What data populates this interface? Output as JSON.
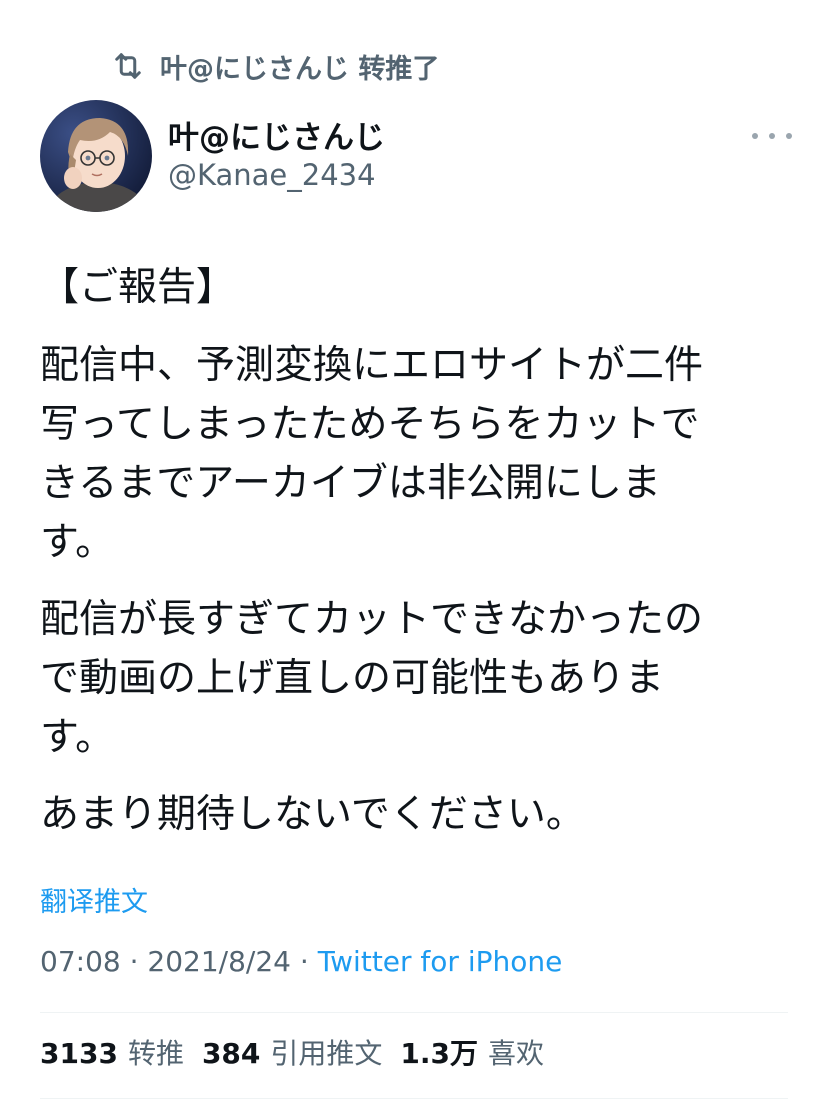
{
  "retweet_context": {
    "icon": "retweet-icon",
    "text": "叶@にじさんじ 转推了"
  },
  "author": {
    "display_name": "叶@にじさんじ",
    "handle": "@Kanae_2434",
    "avatar": "avatar-image"
  },
  "more_icon": "more-horizontal-icon",
  "tweet": {
    "paragraphs": [
      "【ご報告】",
      "配信中、予測変換にエロサイトが二件\n写ってしまったためそちらをカットで\nきるまでアーカイブは非公開にしま\nす。",
      "配信が長すぎてカットできなかったの\nで動画の上げ直しの可能性もありま\nす。",
      "あまり期待しないでください。"
    ]
  },
  "translate_label": "翻译推文",
  "meta": {
    "time": "07:08",
    "sep1": " · ",
    "date": "2021/8/24",
    "sep2": " · ",
    "source": "Twitter for iPhone"
  },
  "stats": {
    "retweets": {
      "count": "3133",
      "label": "转推"
    },
    "quotes": {
      "count": "384",
      "label": "引用推文"
    },
    "likes": {
      "count": "1.3万",
      "label": "喜欢"
    }
  },
  "colors": {
    "accent": "#1d9bf0",
    "secondary_text": "#536471",
    "primary_text": "#0f1419"
  }
}
